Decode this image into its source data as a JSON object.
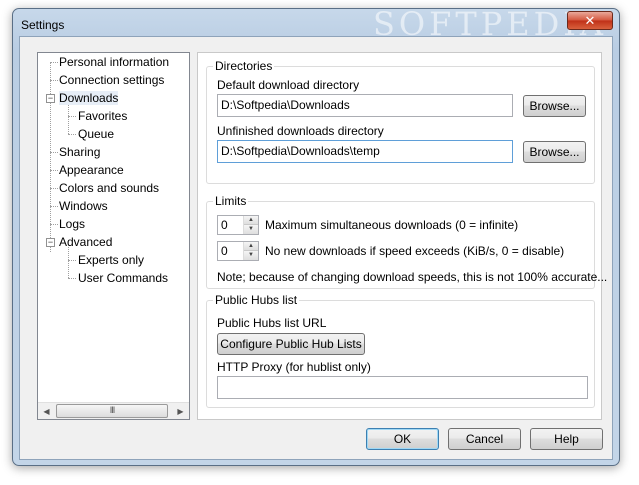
{
  "window": {
    "title": "Settings",
    "close_label": "✕"
  },
  "tree": {
    "items": [
      {
        "label": "Personal information"
      },
      {
        "label": "Connection settings"
      },
      {
        "label": "Downloads"
      },
      {
        "label": "Favorites"
      },
      {
        "label": "Queue"
      },
      {
        "label": "Sharing"
      },
      {
        "label": "Appearance"
      },
      {
        "label": "Colors and sounds"
      },
      {
        "label": "Windows"
      },
      {
        "label": "Logs"
      },
      {
        "label": "Advanced"
      },
      {
        "label": "Experts only"
      },
      {
        "label": "User Commands"
      }
    ],
    "expander_minus": "−",
    "scroll_left": "◀",
    "scroll_right": "▶",
    "scroll_grip": "III"
  },
  "directories": {
    "title": "Directories",
    "default_label": "Default download directory",
    "default_value": "D:\\Softpedia\\Downloads",
    "unfinished_label": "Unfinished downloads directory",
    "unfinished_value": "D:\\Softpedia\\Downloads\\temp",
    "browse_label": "Browse..."
  },
  "limits": {
    "title": "Limits",
    "max_value": "0",
    "max_label": "Maximum simultaneous downloads (0 = infinite)",
    "speed_value": "0",
    "speed_label": "No new downloads if speed exceeds (KiB/s, 0 = disable)",
    "note": "Note; because of changing download speeds, this is not 100% accurate...",
    "spin_up": "▲",
    "spin_down": "▼"
  },
  "hubs": {
    "title": "Public Hubs list",
    "url_label": "Public Hubs list URL",
    "configure_label": "Configure Public Hub Lists",
    "proxy_label": "HTTP Proxy (for hublist only)",
    "proxy_value": ""
  },
  "footer": {
    "ok_label": "OK",
    "cancel_label": "Cancel",
    "help_label": "Help"
  },
  "watermark": {
    "text": "SOFTPEDIA"
  },
  "colors": {
    "frame": "#c3d5e8",
    "close": "#c9422a",
    "default_button_border": "#3c7fb1"
  }
}
